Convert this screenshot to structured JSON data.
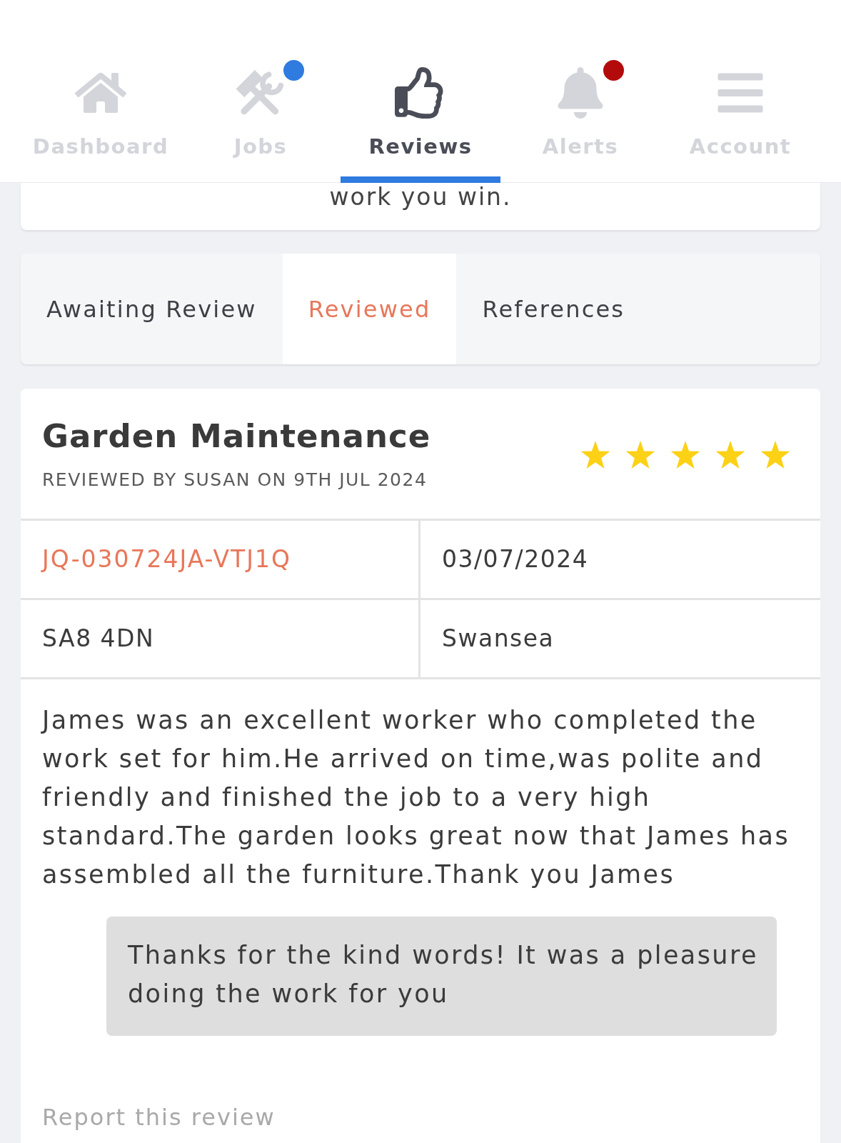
{
  "nav": {
    "items": [
      {
        "label": "Dashboard",
        "selected": false
      },
      {
        "label": "Jobs",
        "selected": false,
        "color": "#2f7be0"
      },
      {
        "label": "Reviews",
        "selected": true
      },
      {
        "label": "Alerts",
        "selected": false,
        "color": "#b30b0b"
      },
      {
        "label": "Account",
        "selected": false
      }
    ]
  },
  "intro_card": {
    "text": "work you win."
  },
  "tabs": [
    {
      "label": "Awaiting Review",
      "selected": false
    },
    {
      "label": "Reviewed",
      "selected": true
    },
    {
      "label": "References",
      "selected": false
    }
  ],
  "review": {
    "title": "Garden Maintenance",
    "subtitle": "REVIEWED BY SUSAN ON 9TH JUL 2024",
    "stars": 5,
    "details": [
      {
        "kind": "link",
        "text": "JQ-030724JA-VTJ1Q"
      },
      {
        "kind": "text",
        "text": "03/07/2024"
      },
      {
        "kind": "text",
        "text": "SA8 4DN"
      },
      {
        "kind": "text",
        "text": "Swansea"
      }
    ],
    "comment": "James was an excellent worker who completed the work set for him.He arrived on time,was polite and friendly and finished the job to a very high standard.The garden looks great now that James has assembled all the furniture.Thank you James",
    "reply": "Thanks for the kind words! It was a pleasure doing the work for you",
    "report_link": "Report this review"
  }
}
